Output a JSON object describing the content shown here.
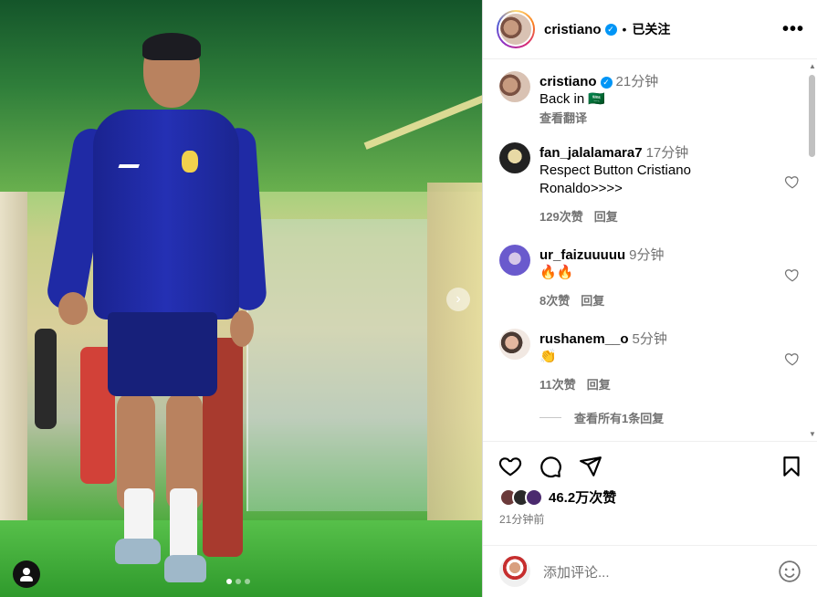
{
  "post": {
    "username": "cristiano",
    "separator": "•",
    "follow_label": "已关注",
    "more_label": "•••"
  },
  "comments": [
    {
      "user": "cristiano",
      "time": "21分钟",
      "text": "Back in 🇸🇦",
      "translate": "查看翻译"
    },
    {
      "user": "fan_jalalamara7",
      "time": "17分钟",
      "text": "Respect Button Cristiano Ronaldo>>>>",
      "likes": "129次赞",
      "reply": "回复"
    },
    {
      "user": "ur_faizuuuuu",
      "time": "9分钟",
      "text": "🔥🔥",
      "likes": "8次赞",
      "reply": "回复"
    },
    {
      "user": "rushanem__o",
      "time": "5分钟",
      "text": "👏",
      "likes": "11次赞",
      "reply": "回复"
    }
  ],
  "view_replies": "查看所有1条回复",
  "stats": {
    "likes": "46.2万次赞",
    "time_ago": "21分钟前"
  },
  "add_comment": {
    "placeholder": "添加评论..."
  },
  "icons": {
    "like": "heart-icon",
    "comment": "comment-icon",
    "share": "share-icon",
    "save": "bookmark-icon",
    "emoji": "smile-icon",
    "next": "chevron-right-icon",
    "tags": "user-tag-icon"
  },
  "colors": {
    "verified": "#0095f6",
    "muted": "#737373"
  }
}
